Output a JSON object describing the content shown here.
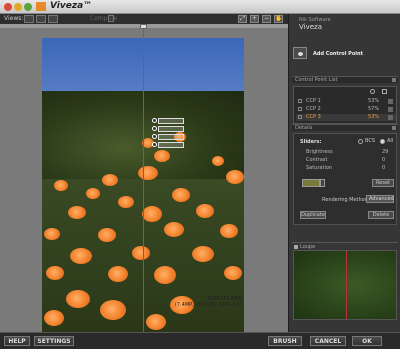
{
  "window": {
    "title": "Viveza™"
  },
  "toolbar": {
    "views_label": "Views:",
    "compare_label": "Compare"
  },
  "photo": {
    "filename": "1099243.RAW",
    "specs": "(7.4MP, 253 180, SMG 4.1)"
  },
  "panel": {
    "brand": "Nik Software",
    "title": "Viveza",
    "add_cp_label": "Add Control Point",
    "cp_list_header": "Control Point List",
    "control_points": [
      {
        "name": "CCP 1",
        "pct": "53%",
        "selected": false
      },
      {
        "name": "CCP 2",
        "pct": "57%",
        "selected": false
      },
      {
        "name": "CCP 3",
        "pct": "53%",
        "selected": true
      }
    ],
    "details_header": "Details",
    "sliders_label": "Sliders:",
    "radio_bcs": "BCS",
    "radio_all": "All",
    "sliders": [
      {
        "name": "Brightness",
        "value": "29"
      },
      {
        "name": "Contrast",
        "value": "0"
      },
      {
        "name": "Saturation",
        "value": "0"
      }
    ],
    "reset_label": "Reset",
    "rendering_label": "Rendering Method:",
    "rendering_value": "Advanced",
    "duplicate_label": "Duplicate",
    "delete_label": "Delete",
    "loupe_header": "Loupe"
  },
  "bottom": {
    "help": "HELP",
    "settings": "SETTINGS",
    "brush": "BRUSH",
    "cancel": "CANCEL",
    "ok": "OK"
  },
  "colors": {
    "accent": "#e88a2a",
    "split_line": "#e0303a"
  }
}
